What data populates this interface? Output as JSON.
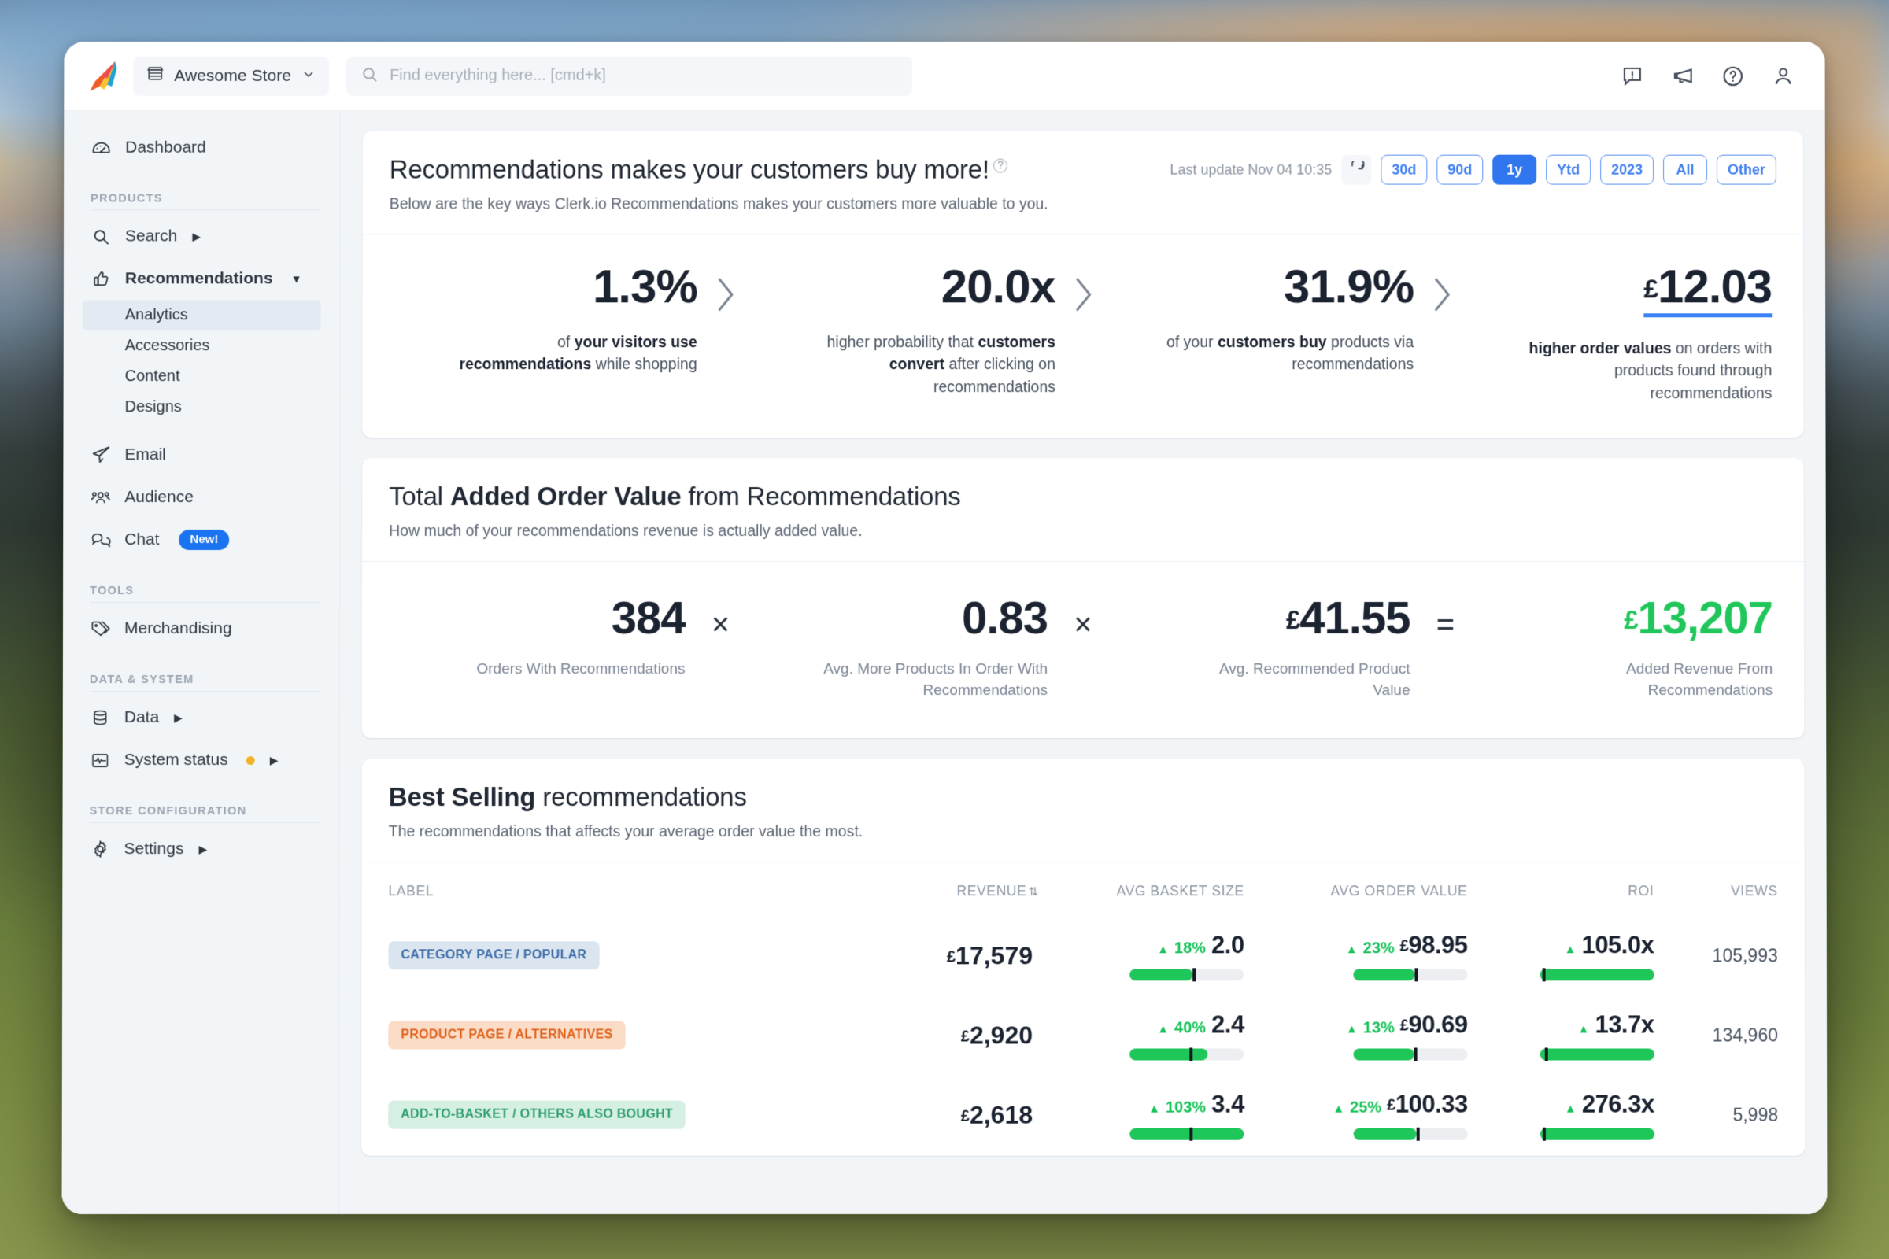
{
  "topbar": {
    "logo_icon": "clerk-rocket-logo",
    "store": {
      "icon": "store-icon",
      "name": "Awesome Store",
      "chevron": "chevron-down-icon"
    },
    "search": {
      "icon": "search-icon",
      "value": "",
      "placeholder": "Find everything here... [cmd+k]"
    },
    "actions": [
      {
        "icon": "feedback-alert-icon",
        "name": "feedback-button"
      },
      {
        "icon": "megaphone-icon",
        "name": "announcements-button"
      },
      {
        "icon": "help-circle-icon",
        "name": "help-button"
      },
      {
        "icon": "user-avatar-icon",
        "name": "account-button"
      }
    ]
  },
  "sidebar": {
    "dashboard": {
      "label": "Dashboard",
      "icon": "dashboard-gauge-icon"
    },
    "sections": [
      {
        "title": "PRODUCTS",
        "items": [
          {
            "label": "Search",
            "icon": "search-icon",
            "has_caret": true,
            "expanded": false
          },
          {
            "label": "Recommendations",
            "icon": "thumbs-up-icon",
            "has_caret": true,
            "expanded": true,
            "bold": true,
            "children": [
              {
                "label": "Analytics",
                "selected": true
              },
              {
                "label": "Accessories",
                "selected": false
              },
              {
                "label": "Content",
                "selected": false
              },
              {
                "label": "Designs",
                "selected": false
              }
            ]
          },
          {
            "label": "Email",
            "icon": "paper-plane-icon",
            "has_caret": false
          },
          {
            "label": "Audience",
            "icon": "people-group-icon",
            "has_caret": false
          },
          {
            "label": "Chat",
            "icon": "chat-bubbles-icon",
            "has_caret": false,
            "badge": "New!"
          }
        ]
      },
      {
        "title": "TOOLS",
        "items": [
          {
            "label": "Merchandising",
            "icon": "price-tags-icon",
            "has_caret": false
          }
        ]
      },
      {
        "title": "DATA & SYSTEM",
        "items": [
          {
            "label": "Data",
            "icon": "database-icon",
            "has_caret": true
          },
          {
            "label": "System status",
            "icon": "activity-monitor-icon",
            "has_caret": true,
            "status_dot": "amber"
          }
        ]
      },
      {
        "title": "STORE CONFIGURATION",
        "items": [
          {
            "label": "Settings",
            "icon": "gear-icon",
            "has_caret": true
          }
        ]
      }
    ]
  },
  "colors": {
    "accent_blue": "#2f76ef",
    "accent_blue_outline": "#5a93f5",
    "green": "#1fc65a",
    "badge_blue": "#1a73f0",
    "amber": "#f0b429"
  },
  "hero_card": {
    "title_plain": "Recommendations makes your customers buy more!",
    "info_icon": "info-circle-icon",
    "subtitle": "Below are the key ways Clerk.io Recommendations makes your customers more valuable to you.",
    "last_update": "Last update Nov 04 10:35",
    "refresh_icon": "refresh-icon",
    "ranges": [
      {
        "label": "30d",
        "active": false
      },
      {
        "label": "90d",
        "active": false
      },
      {
        "label": "1y",
        "active": true
      },
      {
        "label": "Ytd",
        "active": false
      },
      {
        "label": "2023",
        "active": false
      },
      {
        "label": "All",
        "active": false
      },
      {
        "label": "Other",
        "active": false
      }
    ],
    "kpis": [
      {
        "value": "1.3%",
        "currency": "",
        "desc_pre": "of ",
        "desc_b1": "your visitors use recommendations",
        "desc_post": " while shopping",
        "underlined": false
      },
      {
        "value": "20.0x",
        "currency": "",
        "desc_pre": "higher probability that ",
        "desc_b1": "customers convert",
        "desc_post": " after clicking on recommendations",
        "underlined": false
      },
      {
        "value": "31.9%",
        "currency": "",
        "desc_pre": "of your ",
        "desc_b1": "customers buy",
        "desc_post": " products via recommendations",
        "underlined": false
      },
      {
        "value": "12.03",
        "currency": "£",
        "desc_pre": "",
        "desc_b1": "higher order values",
        "desc_post": " on orders with products found through recommendations",
        "underlined": true
      }
    ],
    "separator_icon": "chevron-right-icon"
  },
  "value_card": {
    "title_pre": "Total ",
    "title_bold": "Added Order Value",
    "title_post": " from Recommendations",
    "subtitle": "How much of your recommendations revenue is actually added value.",
    "factors": [
      {
        "value": "384",
        "currency": "",
        "label": "Orders With Recommendations",
        "green": false,
        "op_after": "×"
      },
      {
        "value": "0.83",
        "currency": "",
        "label": "Avg. More Products In Order With Recommendations",
        "green": false,
        "op_after": "×"
      },
      {
        "value": "41.55",
        "currency": "£",
        "label": "Avg. Recommended Product Value",
        "green": false,
        "op_after": "="
      },
      {
        "value": "13,207",
        "currency": "£",
        "label": "Added Revenue From Recommendations",
        "green": true,
        "op_after": ""
      }
    ]
  },
  "best_selling": {
    "title_bold": "Best Selling",
    "title_post": " recommendations",
    "subtitle": "The recommendations that affects your average order value the most.",
    "columns": {
      "label": "LABEL",
      "revenue": "REVENUE",
      "revenue_sort_icon": "sort-updown-icon",
      "basket": "AVG BASKET SIZE",
      "order_value": "AVG ORDER VALUE",
      "roi": "ROI",
      "views": "VIEWS"
    },
    "rows": [
      {
        "tag": "CATEGORY PAGE / POPULAR",
        "tag_color": "blue",
        "revenue_currency": "£",
        "revenue": "17,579",
        "basket_pct": "18%",
        "basket_value": "2.0",
        "basket_currency": "",
        "basket_fill": 55,
        "basket_mark": 55,
        "aov_pct": "23%",
        "aov_value": "98.95",
        "aov_currency": "£",
        "aov_fill": 54,
        "aov_mark": 54,
        "roi_value": "105.0x",
        "roi_fill": 100,
        "roi_mark": 2,
        "views": "105,993"
      },
      {
        "tag": "PRODUCT PAGE / ALTERNATIVES",
        "tag_color": "orange",
        "revenue_currency": "£",
        "revenue": "2,920",
        "basket_pct": "40%",
        "basket_value": "2.4",
        "basket_currency": "",
        "basket_fill": 68,
        "basket_mark": 52,
        "aov_pct": "13%",
        "aov_value": "90.69",
        "aov_currency": "£",
        "aov_fill": 53,
        "aov_mark": 53,
        "roi_value": "13.7x",
        "roi_fill": 100,
        "roi_mark": 4,
        "views": "134,960"
      },
      {
        "tag": "ADD-TO-BASKET / OTHERS ALSO BOUGHT",
        "tag_color": "green",
        "revenue_currency": "£",
        "revenue": "2,618",
        "basket_pct": "103%",
        "basket_value": "3.4",
        "basket_currency": "",
        "basket_fill": 100,
        "basket_mark": 52,
        "aov_pct": "25%",
        "aov_value": "100.33",
        "aov_currency": "£",
        "aov_fill": 55,
        "aov_mark": 55,
        "roi_value": "276.3x",
        "roi_fill": 100,
        "roi_mark": 2,
        "views": "5,998"
      }
    ]
  }
}
